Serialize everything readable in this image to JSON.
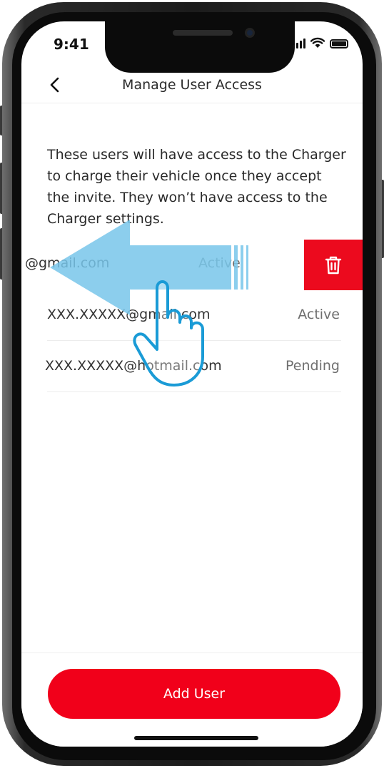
{
  "status_bar": {
    "time": "9:41"
  },
  "nav": {
    "title": "Manage User Access"
  },
  "description": "These users will have access to the Charger to charge their vehicle once they accept the invite. They won’t have access to the Charger settings.",
  "users": [
    {
      "email": "@gmail.com",
      "status": "Active"
    },
    {
      "email": "XXX.XXXXX@gmail.com",
      "status": "Active"
    },
    {
      "email": "XXX.XXXXX@hotmail.com",
      "status": "Pending"
    }
  ],
  "footer": {
    "add_user_label": "Add User"
  },
  "colors": {
    "accent": "#f1001a",
    "delete": "#ec0a1e",
    "swipe_arrow": "#78c6ea",
    "hand_outline": "#1a9bd6"
  },
  "icons": {
    "back": "chevron-left-icon",
    "delete": "trash-icon",
    "gesture": "swipe-left-hand-icon"
  }
}
